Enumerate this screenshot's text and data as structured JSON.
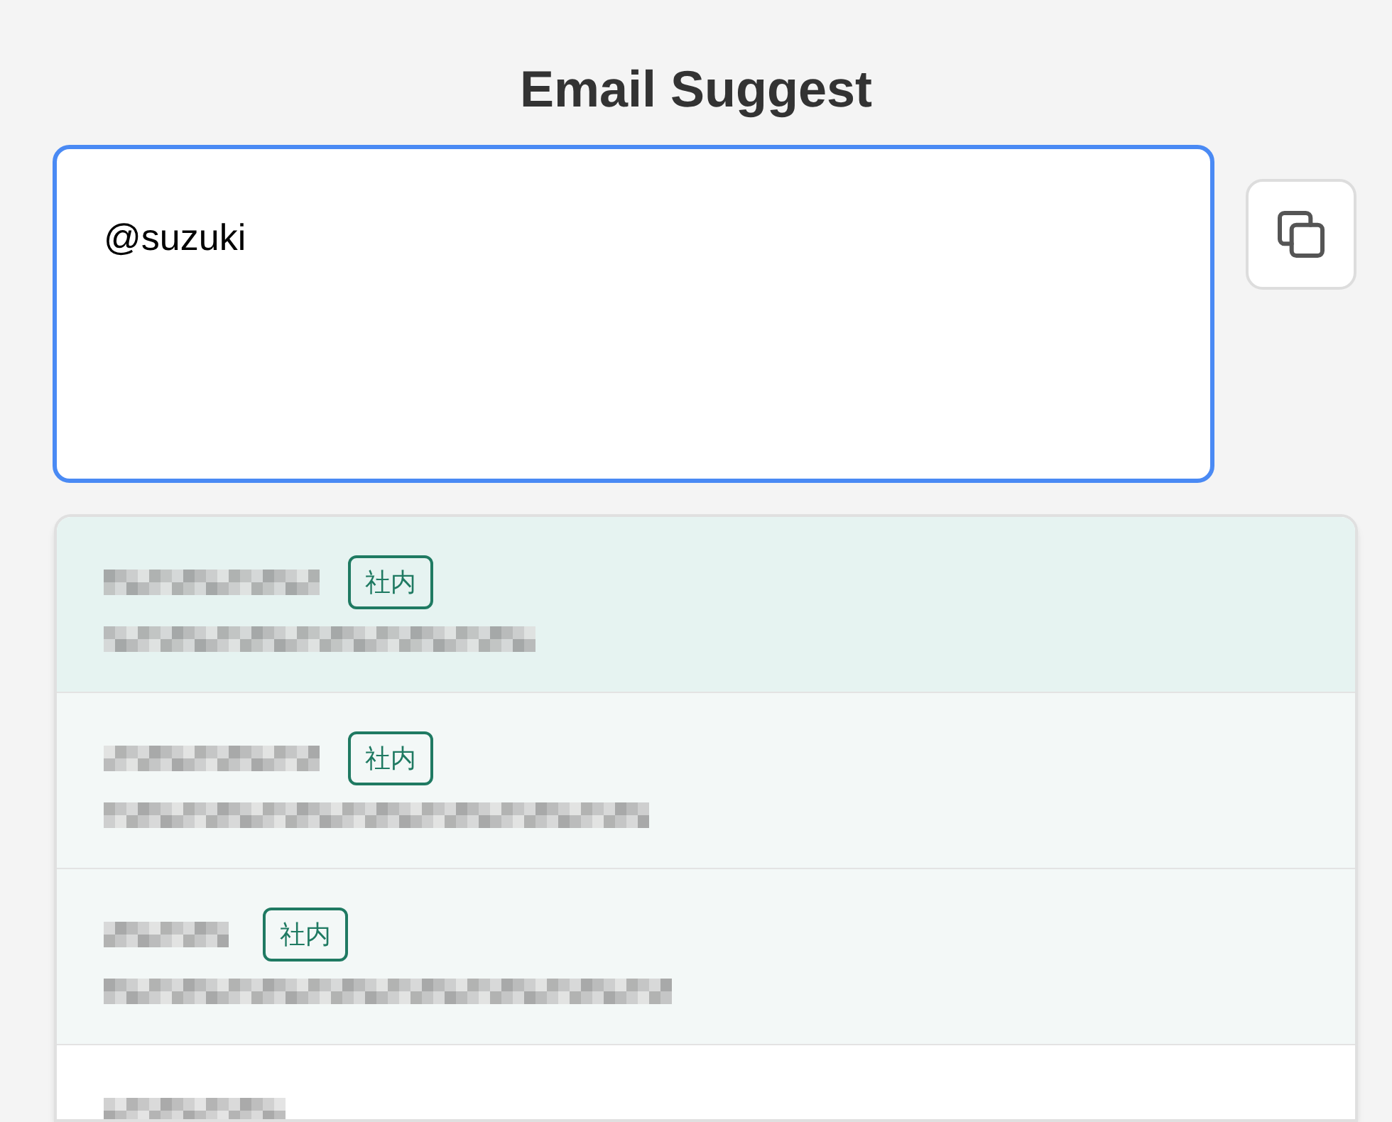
{
  "title": "Email Suggest",
  "input": {
    "value": "@suzuki"
  },
  "copy_button": {
    "disabled": false
  },
  "suggestions": [
    {
      "kind": "internal",
      "selected": true,
      "badge": "社内"
    },
    {
      "kind": "internal",
      "selected": false,
      "badge": "社内"
    },
    {
      "kind": "internal",
      "selected": false,
      "badge": "社内"
    },
    {
      "kind": "external",
      "selected": false
    }
  ]
}
